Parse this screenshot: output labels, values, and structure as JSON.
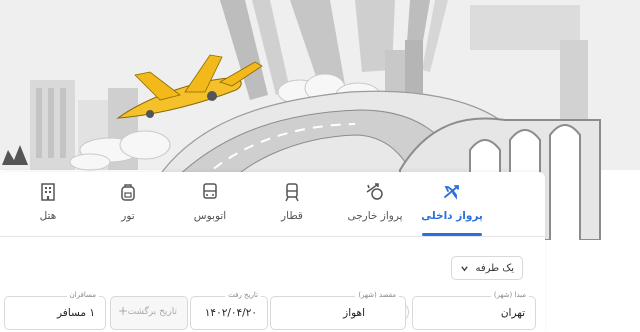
{
  "tabs": [
    {
      "label": "پرواز داخلی",
      "icon": "domestic-flight-icon",
      "active": true
    },
    {
      "label": "پرواز خارجی",
      "icon": "international-flight-icon",
      "active": false
    },
    {
      "label": "قطار",
      "icon": "train-icon",
      "active": false
    },
    {
      "label": "اتوبوس",
      "icon": "bus-icon",
      "active": false
    },
    {
      "label": "تور",
      "icon": "tour-backpack-icon",
      "active": false
    },
    {
      "label": "هتل",
      "icon": "hotel-icon",
      "active": false
    }
  ],
  "trip_type": {
    "label": "یک طرفه",
    "icon": "chevron-down-icon"
  },
  "search": {
    "origin": {
      "label": "مبدا (شهر)",
      "value": "تهران"
    },
    "destination": {
      "label": "مقصد (شهر)",
      "value": "اهواز"
    },
    "departure": {
      "label": "تاریخ رفت",
      "value": "۱۴۰۲/۰۴/۲۰"
    },
    "return": {
      "placeholder": "تاریخ برگشت",
      "icon": "plus-icon"
    },
    "passengers": {
      "label": "مسافران",
      "value": "۱ مسافر"
    },
    "swap_icon": "swap-arrows-icon"
  },
  "colors": {
    "accent": "#2a6fdb",
    "plane": "#f5c12a",
    "hero_gray": "#d9d9d9"
  }
}
